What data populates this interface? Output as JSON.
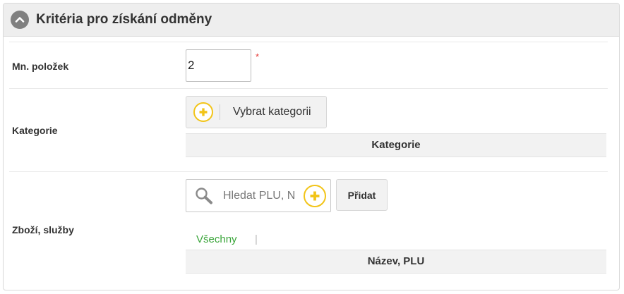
{
  "panel": {
    "title": "Kritéria pro získání odměny",
    "collapse_icon": "chevron-up-icon"
  },
  "rows": {
    "quantity": {
      "label": "Mn. položek",
      "value": "2",
      "required_mark": "*"
    },
    "category": {
      "label": "Kategorie",
      "select_button": "Vybrat kategorii",
      "select_icon": "plus-circle-icon",
      "table_header": "Kategorie"
    },
    "products": {
      "label": "Zboží, služby",
      "search_placeholder": "Hledat PLU, N",
      "search_icon": "magnifier-icon",
      "add_icon": "plus-circle-icon",
      "add_button": "Přidat",
      "filter_all": "Všechny",
      "filter_separator": "|",
      "table_header": "Název, PLU"
    }
  },
  "colors": {
    "header_bg": "#eeeeee",
    "accent_yellow": "#f2c418",
    "filter_green": "#3aa53a",
    "required_red": "#e53935"
  }
}
